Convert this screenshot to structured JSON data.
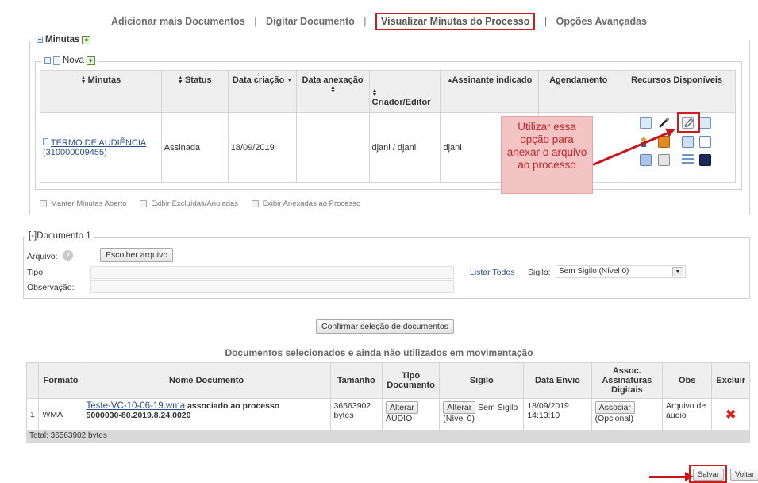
{
  "nav": {
    "add_docs": "Adicionar mais Documentos",
    "type_doc": "Digitar Documento",
    "view_minutas": "Visualizar Minutas do Processo",
    "advanced": "Opções Avançadas",
    "sep": "|"
  },
  "minutas": {
    "legend": "Minutas",
    "nova_legend": "Nova",
    "columns": [
      "Minutas",
      "Status",
      "Data criação",
      "Data anexação",
      "Criador/Editor",
      "Assinante indicado",
      "Agendamento",
      "Recursos Disponíveis"
    ],
    "row": {
      "name": "TERMO DE AUDIÊNCIA",
      "code": "(310000009455)",
      "status": "Assinada",
      "created": "18/09/2019",
      "attached": "",
      "creator": "djani / djani",
      "signer": "djani",
      "schedule": ""
    },
    "callout": "Utilizar essa opção para anexar o arquivo ao processo",
    "options": [
      "Manter Minutas Aberto",
      "Exibir Excluídas/Anuladas",
      "Exibir Anexadas ao Processo"
    ]
  },
  "documento": {
    "legend": "[-]Documento 1",
    "arquivo_label": "Arquivo:",
    "choose_file": "Escolher arquivo",
    "tipo_label": "Tipo:",
    "obs_label": "Observação:",
    "listar_todos": "Listar Todos",
    "sigilo_label": "Sigilo:",
    "sigilo_value": "Sem Sigilo (Nível 0)"
  },
  "confirm_button": "Confirmar seleção de documentos",
  "selected": {
    "title": "Documentos selecionados e ainda não utilizados em movimentação",
    "columns": [
      "",
      "Formato",
      "Nome Documento",
      "Tamanho",
      "Tipo Documento",
      "Sigilo",
      "Data Envio",
      "Assoc. Assinaturas Digitais",
      "Obs",
      "Excluir"
    ],
    "row": {
      "index": "1",
      "format": "WMA",
      "file_link": "Teste-VC-10-06-19.wma",
      "assoc_text": "associado ao processo",
      "process": "5000030-80.2019.8.24.0020",
      "size": "36563902 bytes",
      "alter_label": "Alterar",
      "type_value": "ÁUDIO",
      "sigilo_alter": "Alterar",
      "sigilo_value": "Sem Sigilo (Nível 0)",
      "date": "18/09/2019",
      "time": "14:13:10",
      "associar_label": "Associar",
      "opcional": "(Opcional)",
      "obs": "Arquivo de áudio",
      "delete_symbol": "✖"
    },
    "total": "Total: 36563902 bytes"
  },
  "footer": {
    "save": "Salvar",
    "back": "Voltar"
  },
  "colors": {
    "highlight_red": "#d11a1a",
    "callout_bg": "#f3c4c4",
    "callout_text": "#c0262a",
    "link_blue": "#2b4f86"
  }
}
